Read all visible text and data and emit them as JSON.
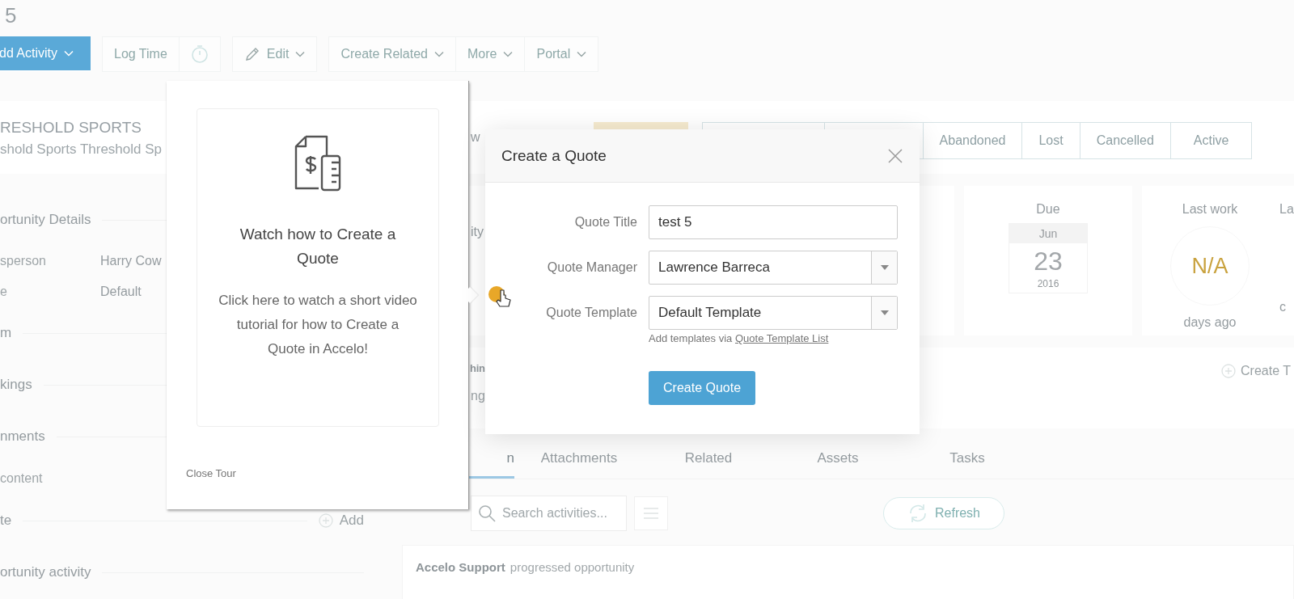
{
  "record_title": "5",
  "toolbar": {
    "groups": [
      {
        "items": [
          {
            "kind": "primary",
            "label": "dd Activity",
            "caret": true
          }
        ]
      },
      {
        "items": [
          {
            "kind": "plain",
            "label": "Log Time",
            "caret": false
          },
          {
            "kind": "timer",
            "caret": false
          }
        ]
      },
      {
        "items": [
          {
            "kind": "edit",
            "label": "Edit",
            "caret": true
          }
        ]
      },
      {
        "items": [
          {
            "kind": "plain",
            "label": "Create Related",
            "caret": true
          },
          {
            "kind": "plain",
            "label": "More",
            "caret": true
          },
          {
            "kind": "plain",
            "label": "Portal",
            "caret": true
          }
        ]
      }
    ]
  },
  "sidebar": {
    "name": "RESHOLD SPORTS",
    "subtitle": "shold Sports Threshold Sp",
    "items": [
      {
        "kind": "heading",
        "text": "ortunity Details"
      },
      {
        "kind": "pair",
        "label": "sperson",
        "value": "Harry Cow"
      },
      {
        "kind": "pair",
        "label": "e",
        "value": "Default"
      },
      {
        "kind": "heading",
        "text": "m"
      },
      {
        "kind": "heading",
        "text": "kings"
      },
      {
        "kind": "heading",
        "text": "nments"
      },
      {
        "kind": "text",
        "text": "content"
      },
      {
        "kind": "heading",
        "text": "te",
        "action": "Add"
      },
      {
        "kind": "heading",
        "text": "ortunity activity"
      }
    ]
  },
  "stage_bar": {
    "fragment": "w",
    "stages": [
      {
        "label": "Abandoned"
      },
      {
        "label": "Lost"
      },
      {
        "label": "Cancelled"
      },
      {
        "label": "Active"
      }
    ]
  },
  "summary": {
    "fragment": "ity",
    "due": {
      "label": "Due",
      "month": "Jun",
      "day": "23",
      "year": "2016"
    },
    "last_work": {
      "label": "Last work",
      "value": "N/A",
      "caption": "days ago"
    },
    "next_fragments": [
      "La",
      "c"
    ]
  },
  "section": {
    "title_fragment": "hin",
    "text_fragment": "ng",
    "action": "Create T"
  },
  "tabs": [
    {
      "label": "n",
      "selected": true
    },
    {
      "label": "Attachments",
      "selected": false
    },
    {
      "label": "Related",
      "selected": false
    },
    {
      "label": "Assets",
      "selected": false
    },
    {
      "label": "Tasks",
      "selected": false
    }
  ],
  "activity_search": {
    "placeholder": "Search activities...",
    "refresh": "Refresh"
  },
  "activity": {
    "actor": "Accelo Support",
    "text": "progressed opportunity"
  },
  "tour": {
    "title": "Watch how to Create a Quote",
    "body": "Click here to watch a short video tutorial for how to Create a Quote in Accelo!",
    "close": "Close Tour"
  },
  "dialog": {
    "title": "Create a Quote",
    "fields": [
      {
        "kind": "text",
        "label": "Quote Title",
        "value": "test 5"
      },
      {
        "kind": "select",
        "label": "Quote Manager",
        "value": "Lawrence Barreca"
      },
      {
        "kind": "select",
        "label": "Quote Template",
        "value": "Default Template"
      }
    ],
    "hint": "Add templates via ",
    "hint_link": "Quote Template List",
    "submit": "Create Quote"
  }
}
